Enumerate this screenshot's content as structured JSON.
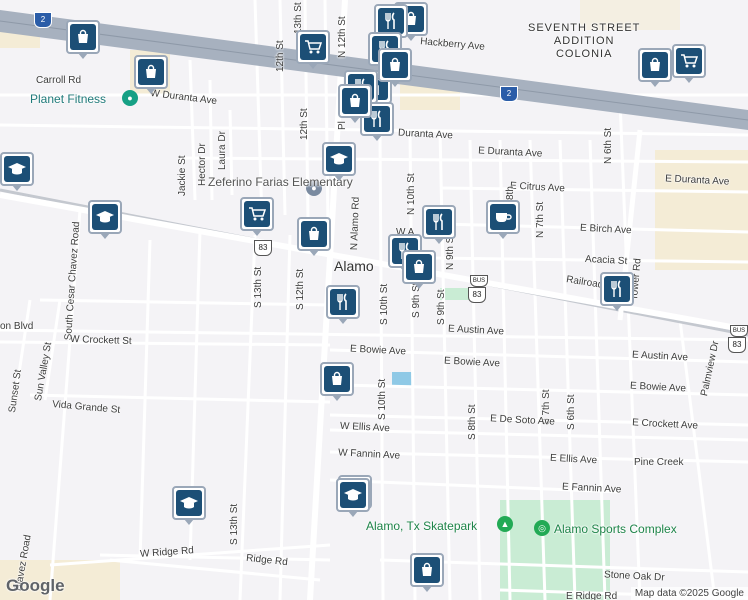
{
  "map": {
    "place_label": "Alamo",
    "district_lines": [
      "SEVENTH STREET",
      "ADDITION",
      "COLONIA"
    ],
    "streets": [
      "Carroll Rd",
      "W Duranta Ave",
      "Hackberry Ave",
      "Duranta Ave",
      "E Duranta Ave",
      "E Duranta Ave",
      "E Citrus Ave",
      "E Birch Ave",
      "Acacia St",
      "Railroad",
      "Jackie St",
      "Hector Dr",
      "Laura Dr",
      "12th St",
      "13th St",
      "12th St",
      "N 12th St",
      "N 10th St",
      "N 9th St",
      "N 8th",
      "N 7th St",
      "N 6th St",
      "N Alamo Rd",
      "Tower Rd",
      "South Cesar Chavez Road",
      "S 13th St",
      "S 12th St",
      "S 10th St",
      "S 9th St",
      "S 9th St",
      "W Crockett St",
      "E Austin Ave",
      "E Austin Ave",
      "E Bowie Ave",
      "E Bowie Ave",
      "E Bowie Ave",
      "S 10th St",
      "S 8th St",
      "S 7th St",
      "S 6th St",
      "E De Soto Ave",
      "E Crockett Ave",
      "Sunset St",
      "Sun Valley St",
      "Vida Grande St",
      "W Ellis Ave",
      "E Ellis Ave",
      "W Fannin Ave",
      "E Fannin Ave",
      "Pine Creek",
      "Palmview Dr",
      "W Ridge Rd",
      "Ridge Rd",
      "S 13th St",
      "Stone Oak Dr",
      "E Ridge Rd",
      "on Blvd",
      "W A",
      "Pl",
      "Blavez Road",
      "R"
    ],
    "pois": [
      "Planet Fitness",
      "Zeferino Farias Elementary",
      "Alamo, Tx Skatepark",
      "Alamo Sports Complex"
    ],
    "route_shields": [
      "2",
      "2",
      "83",
      "83",
      "83",
      "83",
      "BUS",
      "BUS"
    ],
    "markers": [
      "shopping-icon",
      "shopping-icon",
      "cart-icon",
      "restaurant-icon",
      "restaurant-icon",
      "restaurant-icon",
      "shopping-icon",
      "restaurant-icon",
      "shopping-icon",
      "restaurant-icon",
      "school-icon",
      "school-icon",
      "cart-icon",
      "shopping-icon",
      "restaurant-icon",
      "restaurant-icon",
      "shopping-icon",
      "cafe-icon",
      "restaurant-icon",
      "shopping-icon",
      "restaurant-icon",
      "shopping-icon",
      "school-icon",
      "school-icon",
      "shopping-icon",
      "shopping-icon",
      "cart-icon",
      "shopping-icon",
      "school-icon"
    ]
  },
  "branding": {
    "google": "Google",
    "attribution": "Map data ©2025 Google"
  },
  "colors": {
    "background": "#f4f3f6",
    "highway": "#a7b1bf",
    "road": "#ffffff",
    "park": "#c9ecd4",
    "sand": "#f4ecd6",
    "marker": "#1c4f76"
  }
}
